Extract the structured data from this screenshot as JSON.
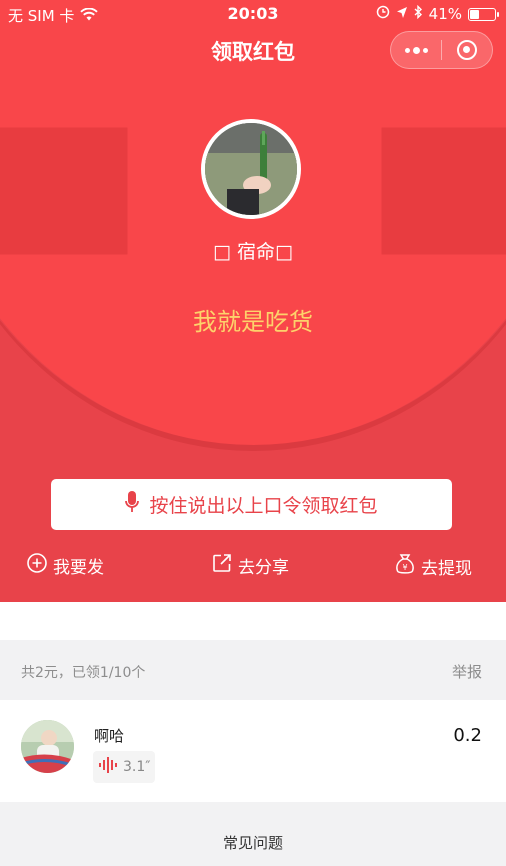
{
  "status_bar": {
    "carrier": "无 SIM 卡",
    "time": "20:03",
    "battery": "41%",
    "battery_level": 0.41,
    "icons": [
      "wifi-icon",
      "location-icon",
      "alarm-icon",
      "bluetooth-icon",
      "battery-icon"
    ]
  },
  "nav": {
    "title": "领取红包",
    "more_icon": "more-dots-icon",
    "close_icon": "target-close-icon"
  },
  "packet": {
    "nickname": "□ 宿命□",
    "message": "我就是吃货",
    "hold_button_label": "按住说出以上口令领取红包",
    "hold_button_icon": "microphone-icon"
  },
  "actions": [
    {
      "label": "我要发",
      "icon": "plus-circle-icon"
    },
    {
      "label": "去分享",
      "icon": "share-icon"
    },
    {
      "label": "去提现",
      "icon": "money-bag-icon"
    }
  ],
  "summary": {
    "text": "共2元，已领1/10个",
    "report": "举报"
  },
  "records": [
    {
      "name": "啊哈",
      "amount": "0.2",
      "voice_duration": "3.1″"
    }
  ],
  "footer": {
    "faq": "常见问题"
  },
  "colors": {
    "red_bg": "#E8434A",
    "red_dome": "#F9464A",
    "message_yellow": "#FDD26B",
    "grey_bg": "#F2F2F3"
  }
}
